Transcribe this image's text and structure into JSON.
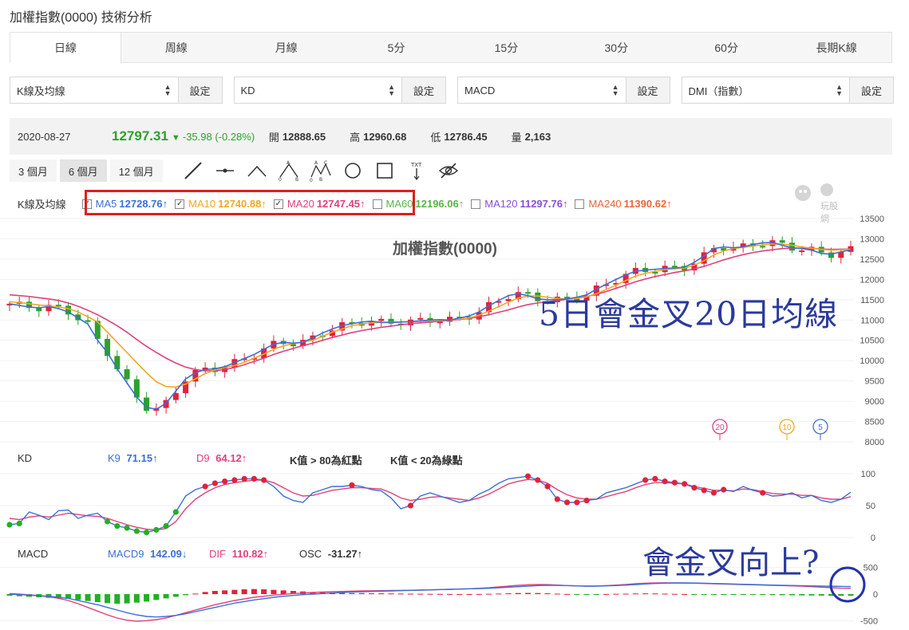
{
  "page": {
    "title": "加權指數(0000) 技術分析"
  },
  "tabs": [
    {
      "label": "日線",
      "active": true
    },
    {
      "label": "周線"
    },
    {
      "label": "月線"
    },
    {
      "label": "5分"
    },
    {
      "label": "15分"
    },
    {
      "label": "30分"
    },
    {
      "label": "60分"
    },
    {
      "label": "長期K線"
    }
  ],
  "selects": [
    {
      "value": "K線及均線",
      "button": "設定"
    },
    {
      "value": "KD",
      "button": "設定"
    },
    {
      "value": "MACD",
      "button": "設定"
    },
    {
      "value": "DMI（指數）",
      "button": "設定"
    }
  ],
  "quote": {
    "date": "2020-08-27",
    "price": "12797.31",
    "change": "-35.98 (-0.28%)",
    "open_label": "開",
    "open": "12888.65",
    "high_label": "高",
    "high": "12960.68",
    "low_label": "低",
    "low": "12786.45",
    "vol_label": "量",
    "volume": "2,163"
  },
  "periods": [
    {
      "label": "3 個月"
    },
    {
      "label": "6 個月",
      "active": true
    },
    {
      "label": "12 個月"
    }
  ],
  "tools": [
    "line-tool-icon",
    "horizontal-line-icon",
    "angle-icon",
    "abc-pattern-icon",
    "abcd-pattern-icon",
    "circle-icon",
    "rectangle-icon",
    "text-tool-icon",
    "hide-icon"
  ],
  "ma_legend": {
    "title": "K線及均線",
    "items": [
      {
        "label": "MA5",
        "value": "12728.76↑",
        "color": "#3b6fd6",
        "checked": true
      },
      {
        "label": "MA10",
        "value": "12740.88↑",
        "color": "#f5a623",
        "checked": true
      },
      {
        "label": "MA20",
        "value": "12747.45↑",
        "color": "#e0407a",
        "checked": true
      },
      {
        "label": "MA60",
        "value": "12196.06↑",
        "color": "#59b548",
        "checked": false
      },
      {
        "label": "MA120",
        "value": "11297.76↑",
        "color": "#8a4fd8",
        "checked": false
      },
      {
        "label": "MA240",
        "value": "11390.62↑",
        "color": "#e8663d",
        "checked": false
      }
    ]
  },
  "logo_text": "玩股網",
  "chart_data": [
    {
      "type": "candlestick",
      "title": "加權指數(0000)",
      "y_ticks": [
        "13500",
        "13000",
        "12500",
        "12000",
        "11500",
        "11000",
        "10500",
        "10000",
        "9500",
        "9000",
        "8500",
        "8000"
      ],
      "ylim": [
        8000,
        13500
      ],
      "ma_markers": [
        "20",
        "10",
        "5"
      ],
      "ma5_trace": [
        11400,
        11360,
        11320,
        11300,
        11330,
        11280,
        11200,
        11050,
        10900,
        10500,
        10200,
        9800,
        9450,
        9100,
        8850,
        8800,
        8950,
        9250,
        9550,
        9700,
        9780,
        9800,
        9850,
        9950,
        10050,
        10150,
        10280,
        10400,
        10450,
        10430,
        10450,
        10560,
        10680,
        10780,
        10860,
        10910,
        10950,
        10970,
        10940,
        10940,
        10950,
        10960,
        10980,
        11000,
        11010,
        11000,
        11050,
        11100,
        11200,
        11350,
        11480,
        11600,
        11650,
        11600,
        11520,
        11500,
        11500,
        11520,
        11560,
        11620,
        11760,
        11880,
        12000,
        12110,
        12200,
        12230,
        12250,
        12270,
        12280,
        12300,
        12420,
        12580,
        12760,
        12800,
        12780,
        12800,
        12860,
        12900,
        12910,
        12840,
        12780,
        12760,
        12720,
        12640,
        12620,
        12680,
        12728
      ],
      "ma10_trace": [
        11450,
        11430,
        11400,
        11370,
        11350,
        11320,
        11280,
        11200,
        11080,
        10950,
        10700,
        10450,
        10200,
        9950,
        9700,
        9480,
        9360,
        9350,
        9420,
        9550,
        9680,
        9770,
        9830,
        9880,
        9960,
        10060,
        10160,
        10280,
        10360,
        10420,
        10460,
        10500,
        10600,
        10700,
        10780,
        10860,
        10900,
        10930,
        10940,
        10950,
        10950,
        10960,
        10970,
        10980,
        10990,
        11000,
        11020,
        11050,
        11120,
        11220,
        11330,
        11440,
        11540,
        11590,
        11590,
        11560,
        11530,
        11520,
        11530,
        11570,
        11650,
        11750,
        11860,
        11970,
        12080,
        12150,
        12200,
        12240,
        12260,
        12280,
        12350,
        12460,
        12600,
        12700,
        12760,
        12790,
        12820,
        12850,
        12870,
        12870,
        12840,
        12800,
        12770,
        12740,
        12720,
        12730,
        12740
      ],
      "ma20_trace": [
        11620,
        11600,
        11580,
        11550,
        11520,
        11480,
        11420,
        11340,
        11240,
        11130,
        11000,
        10860,
        10700,
        10520,
        10350,
        10200,
        10060,
        9940,
        9840,
        9780,
        9750,
        9750,
        9780,
        9830,
        9900,
        9980,
        10060,
        10150,
        10230,
        10300,
        10370,
        10430,
        10500,
        10570,
        10630,
        10690,
        10740,
        10780,
        10820,
        10850,
        10880,
        10910,
        10930,
        10950,
        10970,
        10990,
        11010,
        11040,
        11080,
        11130,
        11190,
        11250,
        11320,
        11380,
        11420,
        11450,
        11480,
        11510,
        11540,
        11580,
        11630,
        11700,
        11780,
        11860,
        11940,
        12010,
        12070,
        12120,
        12170,
        12210,
        12260,
        12320,
        12400,
        12480,
        12550,
        12610,
        12660,
        12700,
        12730,
        12760,
        12770,
        12770,
        12760,
        12750,
        12740,
        12745,
        12747
      ]
    },
    {
      "type": "line",
      "title": "KD",
      "series": [
        {
          "name": "K9",
          "value": "71.15↑",
          "color": "#3b6fd6"
        },
        {
          "name": "D9",
          "value": "64.12↑",
          "color": "#e0407a"
        }
      ],
      "notes": [
        "K值 > 80為紅點",
        "K值 < 20為綠點"
      ],
      "y_ticks": [
        "100",
        "50",
        "0"
      ],
      "ylim": [
        0,
        100
      ],
      "k_trace": [
        20,
        22,
        40,
        35,
        28,
        42,
        43,
        30,
        35,
        38,
        25,
        18,
        15,
        10,
        8,
        12,
        18,
        40,
        65,
        75,
        80,
        85,
        88,
        90,
        92,
        92,
        90,
        80,
        65,
        58,
        55,
        70,
        75,
        80,
        80,
        82,
        80,
        75,
        73,
        62,
        45,
        50,
        65,
        70,
        65,
        60,
        55,
        58,
        68,
        75,
        85,
        92,
        94,
        96,
        90,
        80,
        60,
        55,
        55,
        58,
        60,
        70,
        74,
        78,
        84,
        90,
        92,
        88,
        86,
        84,
        78,
        74,
        70,
        75,
        72,
        80,
        74,
        70,
        65,
        66,
        70,
        62,
        66,
        58,
        55,
        60,
        71
      ],
      "d_trace": [
        30,
        28,
        32,
        34,
        32,
        35,
        38,
        36,
        34,
        33,
        30,
        25,
        20,
        16,
        13,
        12,
        14,
        25,
        45,
        60,
        70,
        78,
        83,
        86,
        88,
        90,
        90,
        86,
        78,
        70,
        65,
        66,
        70,
        74,
        76,
        78,
        78,
        77,
        76,
        70,
        62,
        58,
        60,
        63,
        64,
        62,
        60,
        58,
        62,
        68,
        76,
        84,
        88,
        91,
        90,
        85,
        75,
        67,
        62,
        60,
        60,
        64,
        68,
        72,
        78,
        83,
        86,
        86,
        85,
        84,
        80,
        77,
        74,
        74,
        73,
        76,
        75,
        72,
        69,
        68,
        68,
        66,
        66,
        62,
        60,
        60,
        64
      ],
      "red_dot_indices": [
        20,
        21,
        22,
        23,
        24,
        25,
        26,
        35,
        41,
        53,
        54,
        55,
        56,
        57,
        58,
        59,
        65,
        66,
        67,
        68,
        69,
        70,
        71,
        72,
        73,
        77
      ],
      "green_dot_indices": [
        0,
        1,
        10,
        11,
        12,
        13,
        14,
        15,
        16,
        17
      ]
    },
    {
      "type": "bar",
      "title": "MACD",
      "series": [
        {
          "name": "MACD9",
          "value": "142.09↓",
          "color": "#3b6fd6"
        },
        {
          "name": "DIF",
          "value": "110.82↑",
          "color": "#e0407a"
        },
        {
          "name": "OSC",
          "value": "-31.27↑",
          "color": "#333333"
        }
      ],
      "y_ticks": [
        "500",
        "0",
        "-500"
      ],
      "ylim": [
        -600,
        600
      ],
      "macd_trace": [
        0,
        -10,
        -20,
        -30,
        -40,
        -60,
        -80,
        -120,
        -160,
        -200,
        -250,
        -300,
        -350,
        -390,
        -420,
        -430,
        -420,
        -400,
        -370,
        -330,
        -290,
        -250,
        -210,
        -170,
        -140,
        -110,
        -85,
        -60,
        -40,
        -25,
        -10,
        0,
        10,
        20,
        30,
        40,
        45,
        50,
        55,
        60,
        65,
        70,
        75,
        80,
        85,
        90,
        95,
        100,
        105,
        110,
        120,
        130,
        140,
        150,
        160,
        165,
        165,
        160,
        155,
        150,
        150,
        155,
        160,
        170,
        180,
        190,
        200,
        205,
        210,
        210,
        208,
        205,
        200,
        195,
        190,
        185,
        180,
        175,
        170,
        165,
        162,
        158,
        155,
        150,
        148,
        145,
        142
      ],
      "dif_trace": [
        10,
        0,
        -15,
        -30,
        -50,
        -80,
        -120,
        -180,
        -250,
        -320,
        -390,
        -450,
        -490,
        -510,
        -500,
        -480,
        -450,
        -400,
        -350,
        -300,
        -250,
        -200,
        -160,
        -120,
        -90,
        -60,
        -40,
        -20,
        -5,
        10,
        20,
        30,
        40,
        45,
        50,
        55,
        60,
        62,
        65,
        68,
        70,
        72,
        75,
        80,
        85,
        90,
        95,
        100,
        110,
        120,
        135,
        150,
        165,
        175,
        180,
        178,
        170,
        160,
        155,
        150,
        152,
        160,
        170,
        180,
        195,
        205,
        210,
        212,
        210,
        208,
        205,
        200,
        195,
        190,
        185,
        180,
        175,
        170,
        165,
        160,
        155,
        150,
        140,
        130,
        120,
        112,
        110
      ],
      "osc_trace": [
        -30,
        -40,
        -50,
        -60,
        -70,
        -80,
        -90,
        -110,
        -130,
        -150,
        -170,
        -180,
        -175,
        -160,
        -140,
        -110,
        -80,
        -50,
        -20,
        10,
        40,
        60,
        70,
        80,
        90,
        95,
        90,
        80,
        70,
        60,
        50,
        40,
        35,
        30,
        25,
        20,
        18,
        16,
        14,
        12,
        10,
        8,
        6,
        4,
        3,
        2,
        1,
        1,
        2,
        5,
        10,
        15,
        20,
        22,
        20,
        15,
        8,
        2,
        -2,
        -4,
        -3,
        2,
        6,
        8,
        12,
        14,
        12,
        8,
        4,
        1,
        -2,
        -4,
        -6,
        -8,
        -10,
        -12,
        -14,
        -15,
        -18,
        -20,
        -22,
        -24,
        -26,
        -28,
        -30,
        -31,
        -31
      ]
    }
  ],
  "annotations": {
    "ma_cross": "5日會金叉20日均線",
    "macd_cross": "會金叉向上?"
  }
}
